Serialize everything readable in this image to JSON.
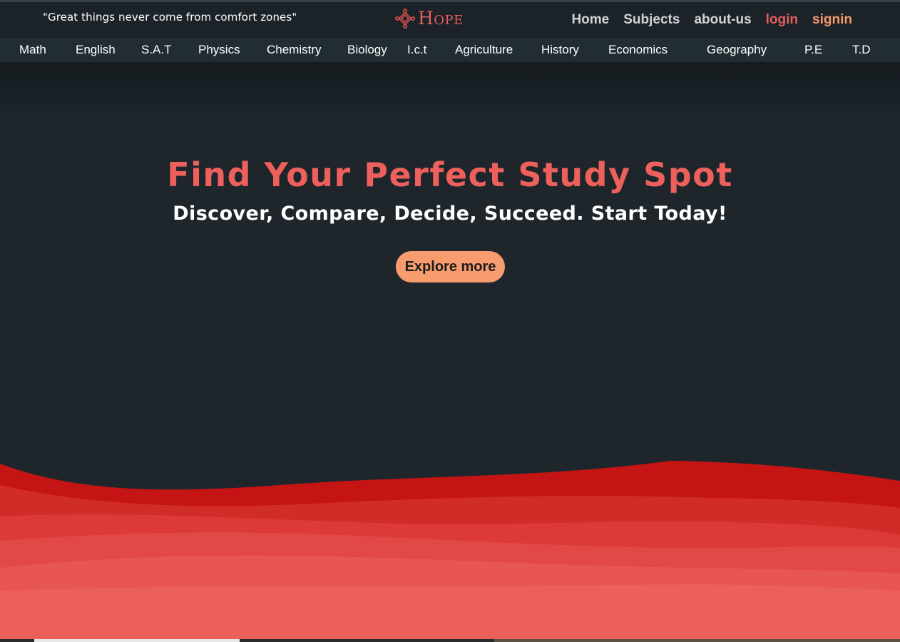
{
  "header": {
    "quote": "\"Great things never come from comfort zones\"",
    "logo_text": "Hope",
    "nav": {
      "home": "Home",
      "subjects": "Subjects",
      "about": "about-us",
      "login": "login",
      "signin": "signin"
    }
  },
  "subjects": [
    "Math",
    "English",
    "S.A.T",
    "Physics",
    "Chemistry",
    "Biology",
    "I.c.t",
    "Agriculture",
    "History",
    "Economics",
    "Geography",
    "P.E",
    "T.D"
  ],
  "hero": {
    "title": "Find Your Perfect Study Spot",
    "subtitle": "Discover, Compare, Decide, Succeed. Start Today!",
    "cta": "Explore more"
  },
  "colors": {
    "accent": "#e35f5e",
    "signin": "#f5996a",
    "button": "#f79c6f",
    "background": "#1e262c"
  }
}
